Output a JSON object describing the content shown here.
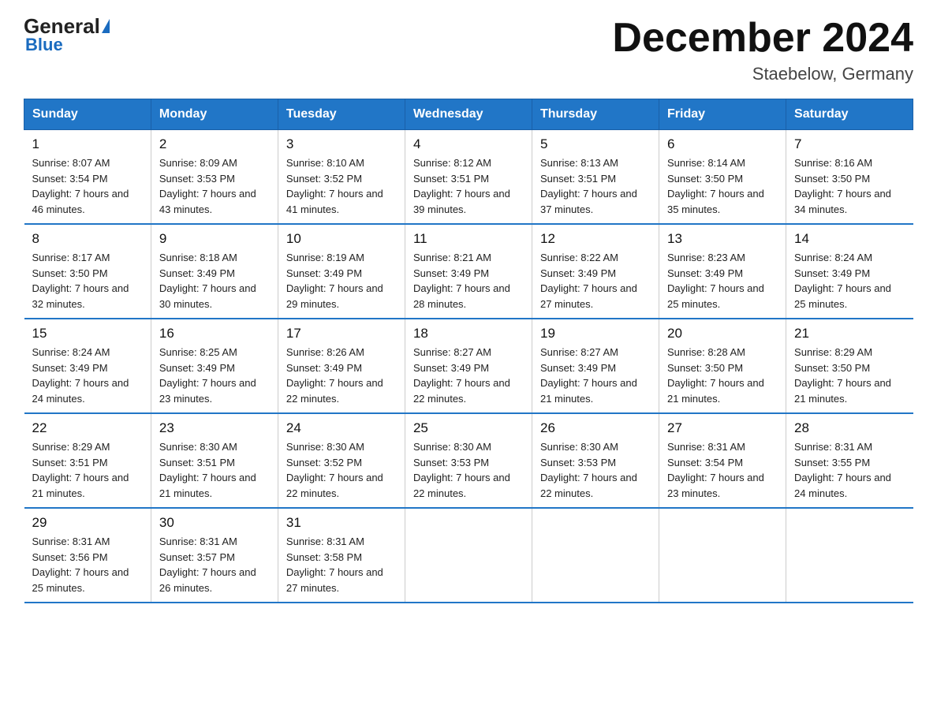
{
  "header": {
    "logo_general": "General",
    "logo_blue": "Blue",
    "main_title": "December 2024",
    "sub_title": "Staebelow, Germany"
  },
  "days_of_week": [
    "Sunday",
    "Monday",
    "Tuesday",
    "Wednesday",
    "Thursday",
    "Friday",
    "Saturday"
  ],
  "weeks": [
    [
      {
        "day": "1",
        "sunrise": "8:07 AM",
        "sunset": "3:54 PM",
        "daylight": "7 hours and 46 minutes."
      },
      {
        "day": "2",
        "sunrise": "8:09 AM",
        "sunset": "3:53 PM",
        "daylight": "7 hours and 43 minutes."
      },
      {
        "day": "3",
        "sunrise": "8:10 AM",
        "sunset": "3:52 PM",
        "daylight": "7 hours and 41 minutes."
      },
      {
        "day": "4",
        "sunrise": "8:12 AM",
        "sunset": "3:51 PM",
        "daylight": "7 hours and 39 minutes."
      },
      {
        "day": "5",
        "sunrise": "8:13 AM",
        "sunset": "3:51 PM",
        "daylight": "7 hours and 37 minutes."
      },
      {
        "day": "6",
        "sunrise": "8:14 AM",
        "sunset": "3:50 PM",
        "daylight": "7 hours and 35 minutes."
      },
      {
        "day": "7",
        "sunrise": "8:16 AM",
        "sunset": "3:50 PM",
        "daylight": "7 hours and 34 minutes."
      }
    ],
    [
      {
        "day": "8",
        "sunrise": "8:17 AM",
        "sunset": "3:50 PM",
        "daylight": "7 hours and 32 minutes."
      },
      {
        "day": "9",
        "sunrise": "8:18 AM",
        "sunset": "3:49 PM",
        "daylight": "7 hours and 30 minutes."
      },
      {
        "day": "10",
        "sunrise": "8:19 AM",
        "sunset": "3:49 PM",
        "daylight": "7 hours and 29 minutes."
      },
      {
        "day": "11",
        "sunrise": "8:21 AM",
        "sunset": "3:49 PM",
        "daylight": "7 hours and 28 minutes."
      },
      {
        "day": "12",
        "sunrise": "8:22 AM",
        "sunset": "3:49 PM",
        "daylight": "7 hours and 27 minutes."
      },
      {
        "day": "13",
        "sunrise": "8:23 AM",
        "sunset": "3:49 PM",
        "daylight": "7 hours and 25 minutes."
      },
      {
        "day": "14",
        "sunrise": "8:24 AM",
        "sunset": "3:49 PM",
        "daylight": "7 hours and 25 minutes."
      }
    ],
    [
      {
        "day": "15",
        "sunrise": "8:24 AM",
        "sunset": "3:49 PM",
        "daylight": "7 hours and 24 minutes."
      },
      {
        "day": "16",
        "sunrise": "8:25 AM",
        "sunset": "3:49 PM",
        "daylight": "7 hours and 23 minutes."
      },
      {
        "day": "17",
        "sunrise": "8:26 AM",
        "sunset": "3:49 PM",
        "daylight": "7 hours and 22 minutes."
      },
      {
        "day": "18",
        "sunrise": "8:27 AM",
        "sunset": "3:49 PM",
        "daylight": "7 hours and 22 minutes."
      },
      {
        "day": "19",
        "sunrise": "8:27 AM",
        "sunset": "3:49 PM",
        "daylight": "7 hours and 21 minutes."
      },
      {
        "day": "20",
        "sunrise": "8:28 AM",
        "sunset": "3:50 PM",
        "daylight": "7 hours and 21 minutes."
      },
      {
        "day": "21",
        "sunrise": "8:29 AM",
        "sunset": "3:50 PM",
        "daylight": "7 hours and 21 minutes."
      }
    ],
    [
      {
        "day": "22",
        "sunrise": "8:29 AM",
        "sunset": "3:51 PM",
        "daylight": "7 hours and 21 minutes."
      },
      {
        "day": "23",
        "sunrise": "8:30 AM",
        "sunset": "3:51 PM",
        "daylight": "7 hours and 21 minutes."
      },
      {
        "day": "24",
        "sunrise": "8:30 AM",
        "sunset": "3:52 PM",
        "daylight": "7 hours and 22 minutes."
      },
      {
        "day": "25",
        "sunrise": "8:30 AM",
        "sunset": "3:53 PM",
        "daylight": "7 hours and 22 minutes."
      },
      {
        "day": "26",
        "sunrise": "8:30 AM",
        "sunset": "3:53 PM",
        "daylight": "7 hours and 22 minutes."
      },
      {
        "day": "27",
        "sunrise": "8:31 AM",
        "sunset": "3:54 PM",
        "daylight": "7 hours and 23 minutes."
      },
      {
        "day": "28",
        "sunrise": "8:31 AM",
        "sunset": "3:55 PM",
        "daylight": "7 hours and 24 minutes."
      }
    ],
    [
      {
        "day": "29",
        "sunrise": "8:31 AM",
        "sunset": "3:56 PM",
        "daylight": "7 hours and 25 minutes."
      },
      {
        "day": "30",
        "sunrise": "8:31 AM",
        "sunset": "3:57 PM",
        "daylight": "7 hours and 26 minutes."
      },
      {
        "day": "31",
        "sunrise": "8:31 AM",
        "sunset": "3:58 PM",
        "daylight": "7 hours and 27 minutes."
      },
      null,
      null,
      null,
      null
    ]
  ]
}
